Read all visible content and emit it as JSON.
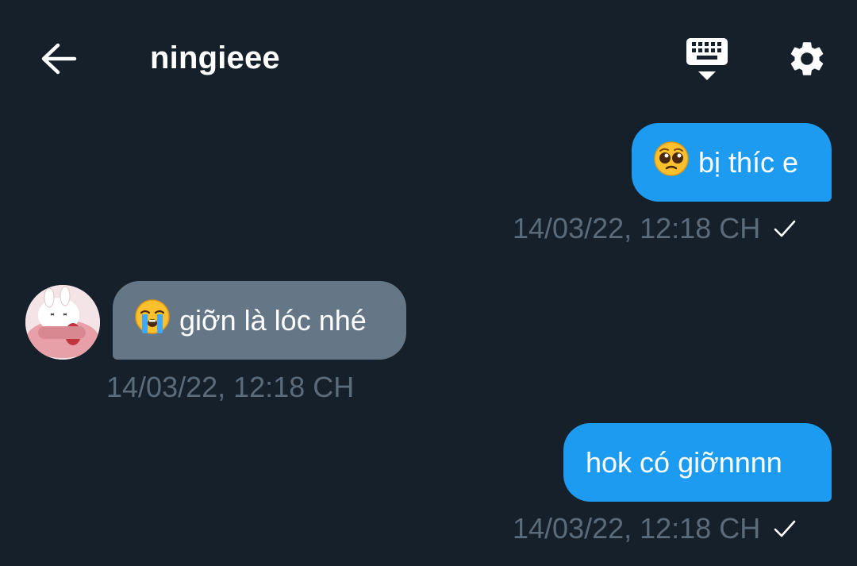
{
  "header": {
    "title": "ningieee",
    "back_icon": "arrow-left-icon",
    "keyboard_icon": "keyboard-icon",
    "settings_icon": "gear-icon"
  },
  "messages": [
    {
      "direction": "outgoing",
      "emoji": "pleading-face-emoji",
      "text": "bị thíc e",
      "timestamp": "14/03/22, 12:18 CH",
      "status_icon": "checkmark-icon"
    },
    {
      "direction": "incoming",
      "emoji": "loudly-crying-face-emoji",
      "text": "giỡn là lóc nhé",
      "timestamp": "14/03/22, 12:18 CH",
      "avatar": "bunny-avatar"
    },
    {
      "direction": "outgoing",
      "text": "hok có giỡnnnn",
      "timestamp": "14/03/22, 12:18 CH",
      "status_icon": "checkmark-icon"
    }
  ],
  "colors": {
    "background": "#15202b",
    "outgoing_bubble": "#1d9bf0",
    "incoming_bubble": "#657786",
    "timestamp": "#5c6b7a"
  }
}
